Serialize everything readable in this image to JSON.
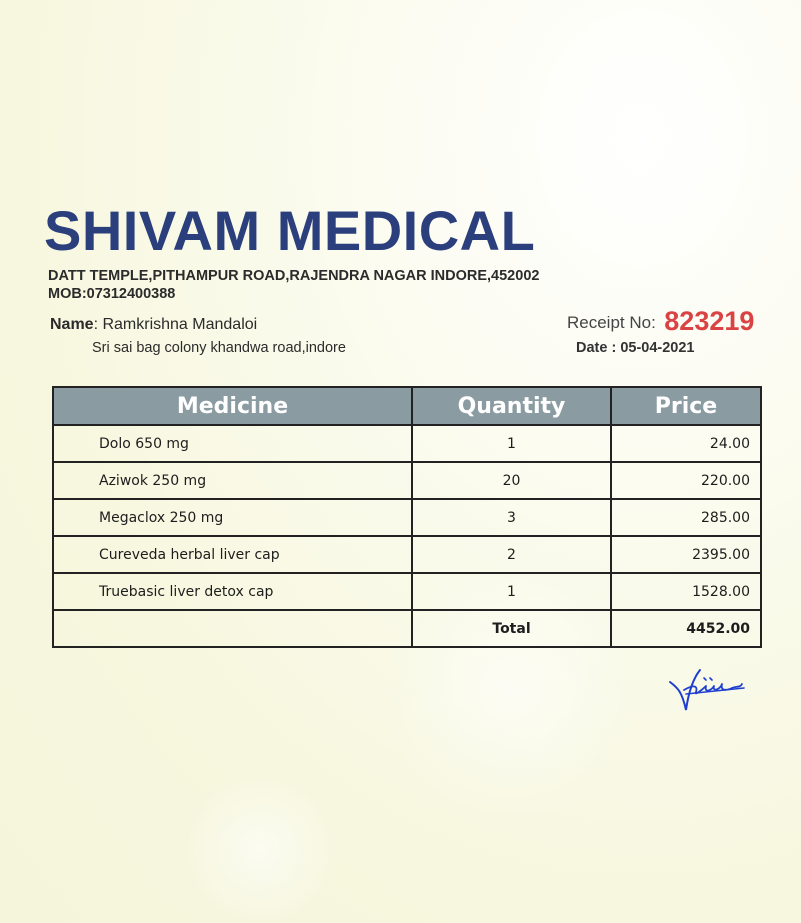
{
  "shop": {
    "name": "SHIVAM MEDICAL",
    "address": "DATT TEMPLE,PITHAMPUR ROAD,RAJENDRA NAGAR INDORE,452002",
    "mobile": "MOB:07312400388"
  },
  "customer": {
    "name_label": "Name",
    "name_separator": ": ",
    "name": "Ramkrishna Mandaloi",
    "address": "Sri sai bag colony khandwa road,indore"
  },
  "receipt": {
    "label": "Receipt No:",
    "number": "823219",
    "date": "Date : 05-04-2021"
  },
  "table": {
    "headers": [
      "Medicine",
      "Quantity",
      "Price"
    ],
    "rows": [
      {
        "medicine": "Dolo 650 mg",
        "quantity": "1",
        "price": "24.00"
      },
      {
        "medicine": "Aziwok 250 mg",
        "quantity": "20",
        "price": "220.00"
      },
      {
        "medicine": "Megaclox 250 mg",
        "quantity": "3",
        "price": "285.00"
      },
      {
        "medicine": "Cureveda herbal liver cap",
        "quantity": "2",
        "price": "2395.00"
      },
      {
        "medicine": "Truebasic liver detox cap",
        "quantity": "1",
        "price": "1528.00"
      }
    ],
    "total_label": "Total",
    "total_value": "4452.00"
  },
  "colors": {
    "shop_name": "#2b3f7c",
    "receipt_number": "#d94343",
    "header_bg": "#8a9ba1",
    "signature_ink": "#1f3fd0"
  },
  "icons": {
    "signature": "handwritten-signature"
  }
}
